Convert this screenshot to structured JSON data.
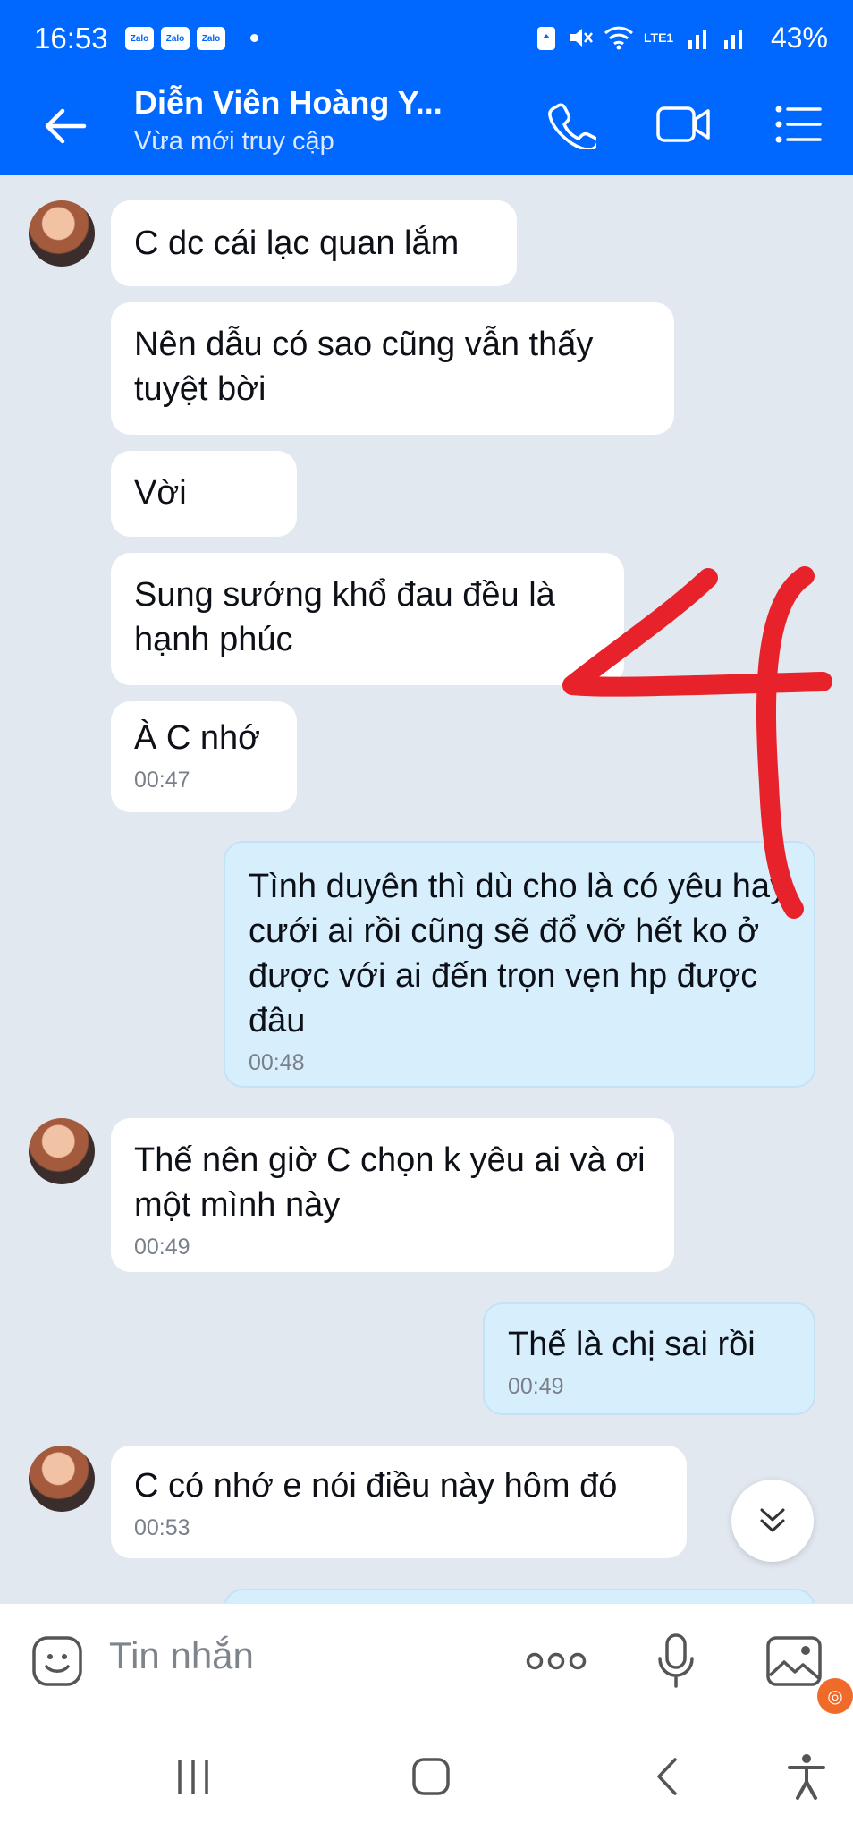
{
  "status_bar": {
    "time": "16:53",
    "app_badges": [
      "Zalo",
      "Zalo",
      "Zalo"
    ],
    "battery": "43%",
    "network": "LTE1"
  },
  "header": {
    "title": "Diễn Viên Hoàng Y...",
    "subtitle": "Vừa mới truy cập",
    "icons": [
      "back-arrow-icon",
      "phone-icon",
      "video-call-icon",
      "menu-icon"
    ]
  },
  "messages": [
    {
      "direction": "in",
      "text": "C dc cái lạc quan lắm",
      "time": ""
    },
    {
      "direction": "in",
      "text": "Nên dẫu có sao cũng vẫn thấy tuyệt bời",
      "time": ""
    },
    {
      "direction": "in",
      "text": "Vời",
      "time": ""
    },
    {
      "direction": "in",
      "text": "Sung sướng khổ đau đều là hạnh phúc",
      "time": ""
    },
    {
      "direction": "in",
      "text": "À C nhớ",
      "time": "00:47"
    },
    {
      "direction": "out",
      "text": "Tình duyên thì dù cho là có yêu hay cưới ai rồi cũng sẽ đổ vỡ hết ko ở được với ai đến trọn vẹn hp được đâu",
      "time": "00:48"
    },
    {
      "direction": "in",
      "text": "Thế nên giờ C chọn k yêu ai và ơi một mình này",
      "time": "00:49"
    },
    {
      "direction": "out",
      "text": "Thế là chị sai rồi",
      "time": "00:49"
    },
    {
      "direction": "in",
      "text": "C có nhớ e nói điều này hôm đó",
      "time": "00:53"
    }
  ],
  "annotation": {
    "text": "4",
    "color": "#e8222a"
  },
  "input": {
    "placeholder": "Tin nhắn",
    "icons": [
      "sticker-icon",
      "more-options-icon",
      "microphone-icon",
      "image-icon"
    ]
  },
  "colors": {
    "brand": "#0068ff",
    "incoming_bubble": "#ffffff",
    "outgoing_bubble": "#d7effd",
    "background": "#e2e8f0"
  }
}
